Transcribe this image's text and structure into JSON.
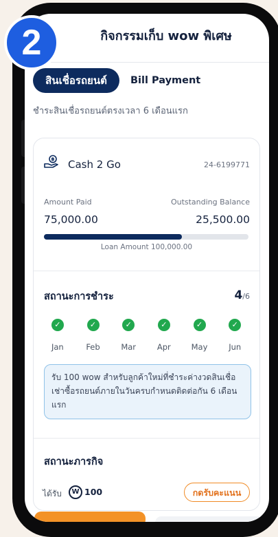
{
  "step_badge": "2",
  "header": {
    "title": "กิจกรรมเก็บ wow พิเศษ"
  },
  "tabs": [
    {
      "label": "สินเชื่อรถยนต์",
      "active": true
    },
    {
      "label": "Bill Payment",
      "active": false
    }
  ],
  "subtitle": "ชำระสินเชื่อรถยนต์ตรงเวลา 6 เดือนแรก",
  "loan": {
    "name": "Cash 2 Go",
    "number": "24-6199771",
    "amount_paid_label": "Amount Paid",
    "amount_paid": "75,000.00",
    "outstanding_label": "Outstanding Balance",
    "outstanding": "25,500.00",
    "progress_fraction": 0.75,
    "loan_amount_text": "Loan Amount 100,000.00"
  },
  "payment_status": {
    "title": "สถานะการชำระ",
    "count": "4",
    "total": "/6",
    "months": [
      "Jan",
      "Feb",
      "Mar",
      "Apr",
      "May",
      "Jun"
    ],
    "info_text": "รับ 100 wow สำหรับลูกค้าใหม่ที่ชำระค่างวดสินเชื่อเช่าซื้อรถยนต์ภายในวันครบกำหนดติดต่อกัน 6 เดือนแรก"
  },
  "mission": {
    "title": "สถานะภารกิจ",
    "reward_label": "ได้รับ",
    "coin_symbol": "W",
    "reward_value": "100",
    "claim_button": "กดรับคะแนน"
  },
  "colors": {
    "navy": "#0d2b5e",
    "check_green": "#21a84e",
    "claim_orange": "#f08a24",
    "badge_blue": "#1e5ee0"
  }
}
